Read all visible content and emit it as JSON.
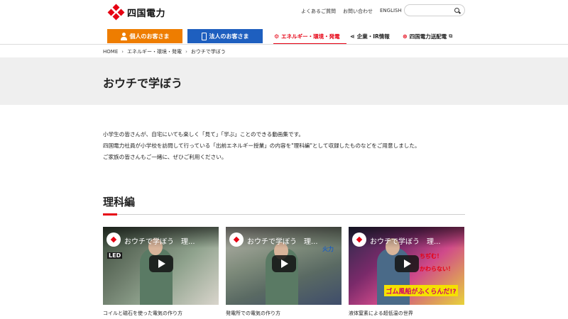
{
  "header": {
    "logo_text": "四国電力",
    "utility_links": [
      "よくあるご質問",
      "お問い合わせ",
      "ENGLISH"
    ],
    "search_placeholder": ""
  },
  "nav": {
    "personal_label": "個人のお客さま",
    "corporate_label": "法人のお客さま",
    "links": [
      {
        "label": "エネルギー・環境・発電",
        "icon": "energy-icon",
        "active": true
      },
      {
        "label": "企業・IR情報",
        "icon": "share-icon",
        "active": false
      },
      {
        "label": "四国電力送配電",
        "icon": "logo-icon",
        "active": false
      }
    ]
  },
  "breadcrumb": [
    "HOME",
    "エネルギー・環境・発電",
    "おウチで学ぼう"
  ],
  "page_title": "おウチで学ぼう",
  "intro": [
    "小学生の皆さんが、自宅にいても楽しく「見て」「学ぶ」ことのできる動画集です。",
    "四国電力社員が小学校を訪問して行っている「出前エネルギー授業」の内容を\"理科編\"として収録したものなどをご用意しました。",
    "ご家族の皆さんもご一緒に、ぜひご利用ください。"
  ],
  "section_title": "理科編",
  "videos": [
    {
      "overlay_title": "おウチで学ぼう　理...",
      "caption": "コイルと磁石を使った電気の作り方",
      "label": "LED"
    },
    {
      "overlay_title": "おウチで学ぼう　理...",
      "caption": "発電所での電気の作り方",
      "label": "火力"
    },
    {
      "overlay_title": "おウチで学ぼう　理...",
      "caption": "液体窒素による超低温の世界",
      "banner": "ゴム風船がふくらんだ!?",
      "side_text": [
        "ちぢむ！",
        "かわらない！"
      ]
    }
  ],
  "colors": {
    "brand_red": "#e60012",
    "personal_orange": "#ee7d00",
    "corporate_blue": "#1e5fbf"
  }
}
